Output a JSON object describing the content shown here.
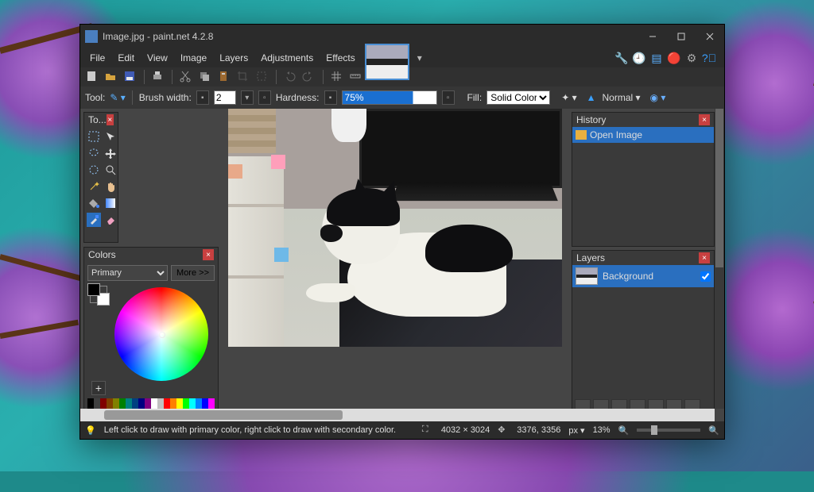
{
  "title": "Image.jpg - paint.net 4.2.8",
  "menus": [
    "File",
    "Edit",
    "View",
    "Image",
    "Layers",
    "Adjustments",
    "Effects"
  ],
  "optbar": {
    "tool_label": "Tool:",
    "brush_label": "Brush width:",
    "brush_value": "2",
    "hardness_label": "Hardness:",
    "hardness_value": "75%",
    "fill_label": "Fill:",
    "fill_value": "Solid Color",
    "blend_value": "Normal"
  },
  "panels": {
    "tools_title": "To...",
    "colors_title": "Colors",
    "colors_dropdown": "Primary",
    "colors_more": "More >>",
    "history_title": "History",
    "history_item": "Open Image",
    "layers_title": "Layers",
    "layer_name": "Background"
  },
  "status": {
    "hint": "Left click to draw with primary color, right click to draw with secondary color.",
    "dims": "4032 × 3024",
    "cursor": "3376, 3356",
    "unit": "px",
    "zoom": "13%"
  },
  "palette": [
    "#000",
    "#404040",
    "#800000",
    "#804000",
    "#808000",
    "#008000",
    "#008080",
    "#004080",
    "#000080",
    "#800080",
    "#fff",
    "#c0c0c0",
    "#f00",
    "#ff8000",
    "#ff0",
    "#0f0",
    "#0ff",
    "#0080ff",
    "#00f",
    "#f0f"
  ]
}
